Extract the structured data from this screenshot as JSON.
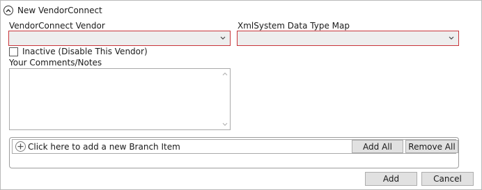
{
  "header": {
    "title": "New VendorConnect"
  },
  "vendor": {
    "label": "VendorConnect Vendor",
    "value": ""
  },
  "type_map": {
    "label": "XmlSystem Data Type Map",
    "value": ""
  },
  "inactive": {
    "label": "Inactive (Disable This Vendor)",
    "checked": false
  },
  "comments": {
    "label": "Your Comments/Notes",
    "value": ""
  },
  "branch": {
    "add_text": "Click here to add a new Branch Item",
    "add_all": "Add All",
    "remove_all": "Remove All"
  },
  "footer": {
    "add": "Add",
    "cancel": "Cancel"
  },
  "colors": {
    "required_border": "#c8353a",
    "button_bg": "#e1e1e1",
    "combo_bg": "#eeeeee"
  }
}
